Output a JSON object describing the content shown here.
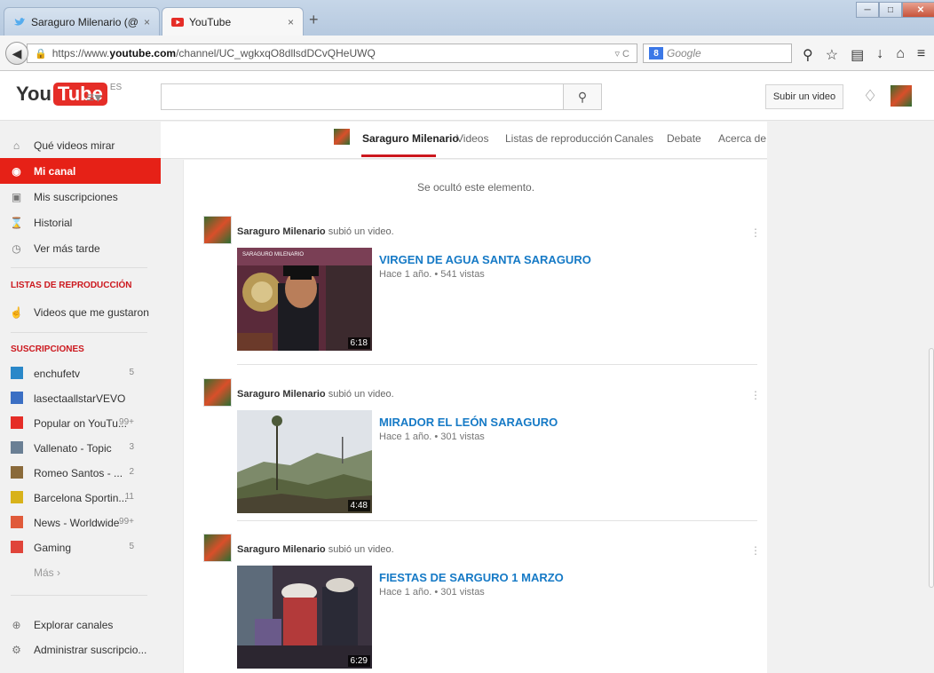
{
  "browser": {
    "tabs": [
      {
        "title": "Saraguro Milenario (@Sara...",
        "close": "×",
        "icon": "twitter-bird-icon"
      },
      {
        "title": "YouTube",
        "close": "×",
        "icon": "youtube-play-icon"
      }
    ],
    "new_tab": "+",
    "url_prefix": "https://www.",
    "url_host": "youtube.com",
    "url_path": "/channel/UC_wgkxqO8dllsdDCvQHeUWQ",
    "search_engine_placeholder": "Google",
    "search_engine_letter": "8"
  },
  "masthead": {
    "logo_you": "You",
    "logo_tube": "Tube",
    "region": "ES",
    "upload_label": "Subir un video"
  },
  "guide": {
    "items": [
      {
        "label": "Qué videos mirar",
        "icon": "home-icon"
      },
      {
        "label": "Mi canal",
        "icon": "user-circle-icon",
        "selected": true
      },
      {
        "label": "Mis suscripciones",
        "icon": "subscriptions-icon"
      },
      {
        "label": "Historial",
        "icon": "hourglass-icon"
      },
      {
        "label": "Ver más tarde",
        "icon": "clock-icon"
      }
    ],
    "playlists_header": "LISTAS DE REPRODUCCIÓN",
    "playlists": [
      {
        "label": "Videos que me gustaron",
        "icon": "thumbs-up-icon"
      }
    ],
    "subs_header": "SUSCRIPCIONES",
    "subscriptions": [
      {
        "name": "enchufetv",
        "count": "5",
        "color": "#2a88c9"
      },
      {
        "name": "lasectaallstarVEVO",
        "count": "",
        "color": "#3b6fc4"
      },
      {
        "name": "Popular on YouTu...",
        "count": "99+",
        "color": "#e52d27"
      },
      {
        "name": "Vallenato - Topic",
        "count": "3",
        "color": "#6a7f94"
      },
      {
        "name": "Romeo Santos - ...",
        "count": "2",
        "color": "#8a6a3a"
      },
      {
        "name": "Barcelona Sportin...",
        "count": "11",
        "color": "#d8b21a"
      },
      {
        "name": "News - Worldwide",
        "count": "99+",
        "color": "#e05a3a"
      },
      {
        "name": "Gaming",
        "count": "5",
        "color": "#e0443a"
      }
    ],
    "more": "Más ›",
    "bottom": [
      {
        "label": "Explorar canales",
        "icon": "plus-circle-icon"
      },
      {
        "label": "Administrar suscripcio...",
        "icon": "gear-icon"
      }
    ]
  },
  "channel_nav": {
    "tabs": [
      "Saraguro Milenario",
      "Videos",
      "Listas de reproducción",
      "Canales",
      "Debate",
      "Acerca de"
    ]
  },
  "feed": {
    "hidden_note": "Se ocultó este elemento.",
    "items": [
      {
        "actor": "Saraguro Milenario",
        "action": " subió un video.",
        "title": "VIRGEN DE AGUA SANTA SARAGURO",
        "meta": "Hace 1 año. • 541 vistas",
        "duration": "6:18",
        "overlay": "SARAGURO MILENARIO"
      },
      {
        "actor": "Saraguro Milenario",
        "action": " subió un video.",
        "title": "MIRADOR EL LEÓN SARAGURO",
        "meta": "Hace 1 año. • 301 vistas",
        "duration": "4:48"
      },
      {
        "actor": "Saraguro Milenario",
        "action": " subió un video.",
        "title": "FIESTAS DE SARGURO 1 MARZO",
        "meta": "Hace 1 año. • 301 vistas",
        "duration": "6:29"
      }
    ]
  }
}
